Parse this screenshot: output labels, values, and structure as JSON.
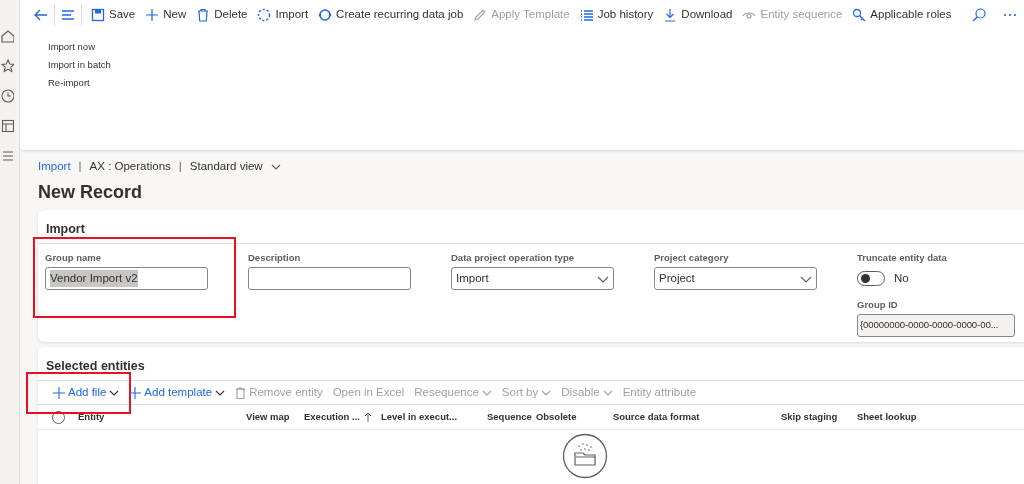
{
  "toolbar": {
    "items": [
      {
        "label": "Save",
        "disabled": false
      },
      {
        "label": "New",
        "disabled": false
      },
      {
        "label": "Delete",
        "disabled": false
      },
      {
        "label": "Import",
        "disabled": false
      },
      {
        "label": "Create recurring data job",
        "disabled": false
      },
      {
        "label": "Apply Template",
        "disabled": true
      },
      {
        "label": "Job history",
        "disabled": false
      },
      {
        "label": "Download",
        "disabled": false
      },
      {
        "label": "Entity sequence",
        "disabled": true
      },
      {
        "label": "Applicable roles",
        "disabled": false
      }
    ],
    "import_menu": [
      "Import now",
      "Import in batch",
      "Re-import"
    ]
  },
  "breadcrumb": [
    {
      "kind": "link",
      "text": "Import"
    },
    {
      "kind": "separator",
      "text": "|"
    },
    {
      "kind": "item",
      "text": "AX : Operations"
    },
    {
      "kind": "separator",
      "text": "|"
    },
    {
      "kind": "view",
      "text": "Standard view"
    }
  ],
  "title": "New Record",
  "import_section": {
    "title": "Import",
    "fields": [
      {
        "kind": "text",
        "label": "Group name",
        "value": "Vendor Import v2",
        "text_selected": true,
        "highlighted": true
      },
      {
        "kind": "text",
        "label": "Description",
        "highlighted": false
      },
      {
        "kind": "select",
        "label": "Data project operation type",
        "value": "Import",
        "highlighted": false
      },
      {
        "kind": "select",
        "label": "Project category",
        "value": "Project",
        "highlighted": false
      },
      {
        "kind": "toggle",
        "label": "Truncate entity data",
        "on": false,
        "value": "No",
        "highlighted": false
      },
      {
        "kind": "readonly",
        "label": "Group ID",
        "value": "{00000000-0000-0000-0000-00...",
        "highlighted": false
      }
    ]
  },
  "entities_section": {
    "title": "Selected entities",
    "actions": [
      {
        "label": "Add file",
        "disabled": false,
        "caret": true,
        "highlighted": true
      },
      {
        "label": "Add template",
        "disabled": false,
        "caret": true,
        "highlighted": false
      },
      {
        "label": "Remove entity",
        "disabled": true,
        "caret": false,
        "highlighted": false
      },
      {
        "label": "Open in Excel",
        "disabled": true,
        "caret": false,
        "highlighted": false
      },
      {
        "label": "Resequence",
        "disabled": true,
        "caret": true,
        "highlighted": false
      },
      {
        "label": "Sort by",
        "disabled": true,
        "caret": true,
        "highlighted": false
      },
      {
        "label": "Disable",
        "disabled": true,
        "caret": true,
        "highlighted": false
      },
      {
        "label": "Entity attribute",
        "disabled": true,
        "caret": false,
        "highlighted": false
      }
    ],
    "select_all": false,
    "columns": [
      {
        "label": "Entity",
        "sorted": false
      },
      {
        "label": "View map",
        "sorted": false
      },
      {
        "label": "Execution ...",
        "sorted": true
      },
      {
        "label": "Level in execut...",
        "sorted": false
      },
      {
        "label": "Sequence",
        "sorted": false
      },
      {
        "label": "Obsolete",
        "sorted": false
      },
      {
        "label": "Source data format",
        "sorted": false
      },
      {
        "label": "Skip staging",
        "sorted": false
      },
      {
        "label": "Sheet lookup",
        "sorted": false
      }
    ]
  }
}
